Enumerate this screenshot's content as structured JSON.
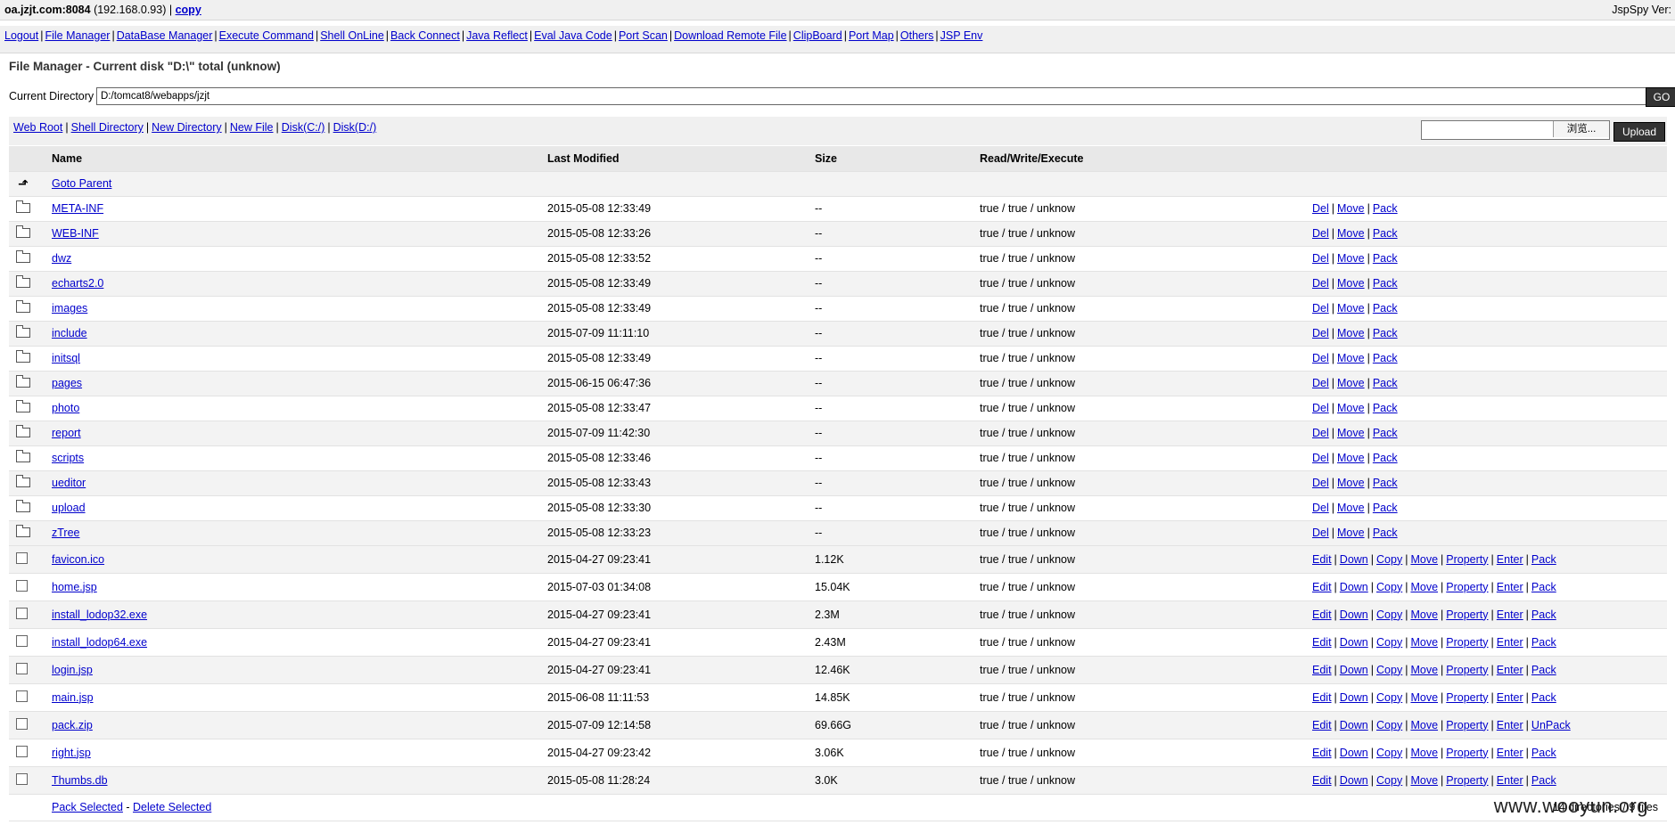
{
  "header": {
    "host": "oa.jzjt.com:8084",
    "ip": "(192.168.0.93)",
    "copy_label": "copy",
    "version": "JspSpy Ver:"
  },
  "menu": [
    "Logout",
    "File Manager",
    "DataBase Manager",
    "Execute Command",
    "Shell OnLine",
    "Back Connect",
    "Java Reflect",
    "Eval Java Code",
    "Port Scan",
    "Download Remote File",
    "ClipBoard",
    "Port Map",
    "Others",
    "JSP Env"
  ],
  "page_title": "File Manager - Current disk \"D:\\\" total (unknow)",
  "current_directory": {
    "label": "Current Directory",
    "value": "D:/tomcat8/webapps/jzjt",
    "go_label": "GO"
  },
  "toolbar": {
    "links": [
      "Web Root",
      "Shell Directory",
      "New Directory",
      "New File",
      "Disk(C:/)",
      "Disk(D:/)"
    ],
    "browse_label": "浏览...",
    "upload_label": "Upload"
  },
  "table": {
    "headers": {
      "name": "Name",
      "modified": "Last Modified",
      "size": "Size",
      "rwx": "Read/Write/Execute"
    },
    "parent_label": "Goto Parent",
    "directories": [
      {
        "name": "META-INF",
        "modified": "2015-05-08 12:33:49",
        "size": "--",
        "rwx": "true / true / unknow"
      },
      {
        "name": "WEB-INF",
        "modified": "2015-05-08 12:33:26",
        "size": "--",
        "rwx": "true / true / unknow"
      },
      {
        "name": "dwz",
        "modified": "2015-05-08 12:33:52",
        "size": "--",
        "rwx": "true / true / unknow"
      },
      {
        "name": "echarts2.0",
        "modified": "2015-05-08 12:33:49",
        "size": "--",
        "rwx": "true / true / unknow"
      },
      {
        "name": "images",
        "modified": "2015-05-08 12:33:49",
        "size": "--",
        "rwx": "true / true / unknow"
      },
      {
        "name": "include",
        "modified": "2015-07-09 11:11:10",
        "size": "--",
        "rwx": "true / true / unknow"
      },
      {
        "name": "initsql",
        "modified": "2015-05-08 12:33:49",
        "size": "--",
        "rwx": "true / true / unknow"
      },
      {
        "name": "pages",
        "modified": "2015-06-15 06:47:36",
        "size": "--",
        "rwx": "true / true / unknow"
      },
      {
        "name": "photo",
        "modified": "2015-05-08 12:33:47",
        "size": "--",
        "rwx": "true / true / unknow"
      },
      {
        "name": "report",
        "modified": "2015-07-09 11:42:30",
        "size": "--",
        "rwx": "true / true / unknow"
      },
      {
        "name": "scripts",
        "modified": "2015-05-08 12:33:46",
        "size": "--",
        "rwx": "true / true / unknow"
      },
      {
        "name": "ueditor",
        "modified": "2015-05-08 12:33:43",
        "size": "--",
        "rwx": "true / true / unknow"
      },
      {
        "name": "upload",
        "modified": "2015-05-08 12:33:30",
        "size": "--",
        "rwx": "true / true / unknow"
      },
      {
        "name": "zTree",
        "modified": "2015-05-08 12:33:23",
        "size": "--",
        "rwx": "true / true / unknow"
      }
    ],
    "dir_actions": [
      "Del",
      "Move",
      "Pack"
    ],
    "files": [
      {
        "name": "favicon.ico",
        "modified": "2015-04-27 09:23:41",
        "size": "1.12K",
        "rwx": "true / true / unknow",
        "actions": [
          "Edit",
          "Down",
          "Copy",
          "Move",
          "Property",
          "Enter",
          "Pack"
        ]
      },
      {
        "name": "home.jsp",
        "modified": "2015-07-03 01:34:08",
        "size": "15.04K",
        "rwx": "true / true / unknow",
        "actions": [
          "Edit",
          "Down",
          "Copy",
          "Move",
          "Property",
          "Enter",
          "Pack"
        ]
      },
      {
        "name": "install_lodop32.exe",
        "modified": "2015-04-27 09:23:41",
        "size": "2.3M",
        "rwx": "true / true / unknow",
        "actions": [
          "Edit",
          "Down",
          "Copy",
          "Move",
          "Property",
          "Enter",
          "Pack"
        ]
      },
      {
        "name": "install_lodop64.exe",
        "modified": "2015-04-27 09:23:41",
        "size": "2.43M",
        "rwx": "true / true / unknow",
        "actions": [
          "Edit",
          "Down",
          "Copy",
          "Move",
          "Property",
          "Enter",
          "Pack"
        ]
      },
      {
        "name": "login.jsp",
        "modified": "2015-04-27 09:23:41",
        "size": "12.46K",
        "rwx": "true / true / unknow",
        "actions": [
          "Edit",
          "Down",
          "Copy",
          "Move",
          "Property",
          "Enter",
          "Pack"
        ]
      },
      {
        "name": "main.jsp",
        "modified": "2015-06-08 11:11:53",
        "size": "14.85K",
        "rwx": "true / true / unknow",
        "actions": [
          "Edit",
          "Down",
          "Copy",
          "Move",
          "Property",
          "Enter",
          "Pack"
        ]
      },
      {
        "name": "pack.zip",
        "modified": "2015-07-09 12:14:58",
        "size": "69.66G",
        "rwx": "true / true / unknow",
        "actions": [
          "Edit",
          "Down",
          "Copy",
          "Move",
          "Property",
          "Enter",
          "UnPack"
        ]
      },
      {
        "name": "right.jsp",
        "modified": "2015-04-27 09:23:42",
        "size": "3.06K",
        "rwx": "true / true / unknow",
        "actions": [
          "Edit",
          "Down",
          "Copy",
          "Move",
          "Property",
          "Enter",
          "Pack"
        ]
      },
      {
        "name": "Thumbs.db",
        "modified": "2015-05-08 11:28:24",
        "size": "3.0K",
        "rwx": "true / true / unknow",
        "actions": [
          "Edit",
          "Down",
          "Copy",
          "Move",
          "Property",
          "Enter",
          "Pack"
        ]
      }
    ],
    "footer": {
      "pack_selected": "Pack Selected",
      "delete_selected": "Delete Selected",
      "summary": "14 directories / 9 files"
    }
  },
  "watermark": "www.wooyun.org"
}
